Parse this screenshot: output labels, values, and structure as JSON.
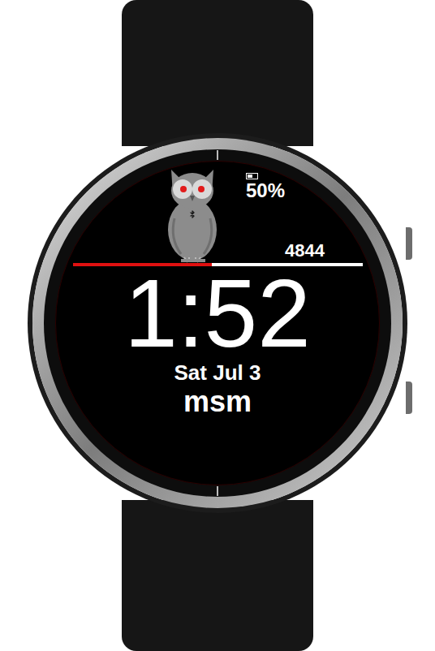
{
  "watch_face": {
    "battery": {
      "text": "50%",
      "level": 0.5
    },
    "bluetooth_connected": true,
    "steps": {
      "count": "4844",
      "level": 0.48
    },
    "time": "1:52",
    "date": "Sat Jul 3",
    "name": "msm"
  }
}
